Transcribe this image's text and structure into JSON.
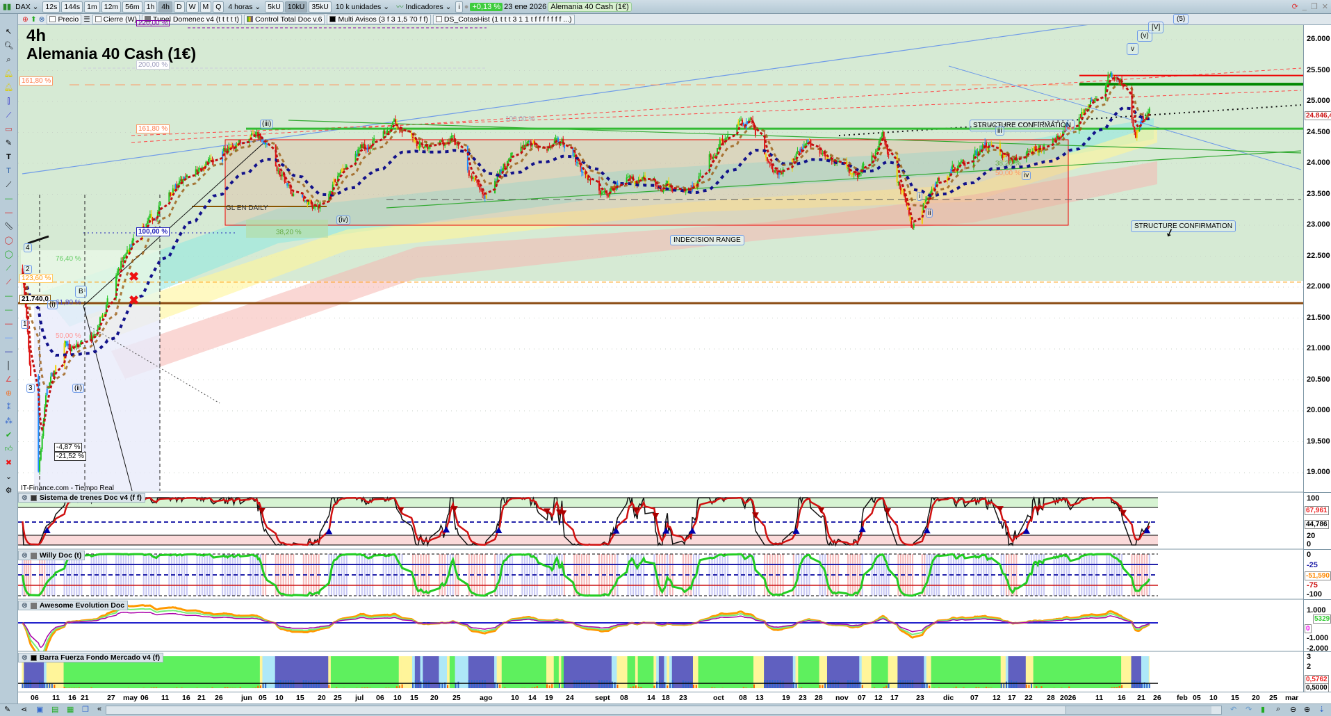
{
  "toolbar": {
    "symbol": "DAX",
    "periods": [
      "12s",
      "144s",
      "1m",
      "12m",
      "56m",
      "1h",
      "4h",
      "D",
      "W",
      "M",
      "Q"
    ],
    "active_period": "4h",
    "period_select": "4 horas",
    "units": [
      "5kU",
      "10kU",
      "35kU"
    ],
    "active_unit": "10kU",
    "units_select": "10 k unidades",
    "indicators": "Indicadores",
    "change": "+0,13 %",
    "date": "23 ene 2026",
    "instrument": "Alemania 40 Cash (1€)"
  },
  "indicator_bar": {
    "items": [
      "Precio",
      "Cierre (W)",
      "Tunel Domenec v4 (t t t t t)",
      "Control Total Doc v.6",
      "Multi Avisos (3 f 3 1,5 70 f f)",
      "DS_CotasHist (1 t t t 3 1 1 t f f f f f f f ...)"
    ]
  },
  "chart_title": {
    "timeframe": "4h",
    "name": "Alemania 40 Cash (1€)"
  },
  "source": "IT-Finance.com - Tiempo Real",
  "annotations": {
    "fib220": "220,00 %",
    "fib200": "200,00 %",
    "fib1618a": "161,80 %",
    "fib1618b": "161,80 %",
    "fib100": "100,00 %",
    "fib764": "76,40 %",
    "fib1236": "123,60 %",
    "level": "21.740,0",
    "fib618": "61,80 %",
    "fib50": "50,00 %",
    "fib382": "38,20 %",
    "fib100b": "100,00 %",
    "fib382b": "38,20 %",
    "fib50b": "50,00 %",
    "gl_daily": "GL EN DAILY",
    "indecision": "INDECISION RANGE",
    "structure1": "STRUCTURE CONFIRMATION",
    "structure2": "STRUCTURE CONFIRMATION",
    "pct1": "-4,87 %",
    "pct2": "-21,52 %"
  },
  "waves": {
    "w_iii": "(iii)",
    "w_iv": "(iv)",
    "w3": "iii",
    "w4": "iv",
    "w1": "i",
    "w2": "ii",
    "wv": "v",
    "wv2": "(v)",
    "wV": "[V]",
    "w5": "(5)",
    "wB": "B",
    "wi": "(i)",
    "wii": "(ii)",
    "n4": "4",
    "n2": "2",
    "n1": "1",
    "n3": "3"
  },
  "price_axis": {
    "ticks": [
      26000,
      25500,
      25000,
      24500,
      24000,
      23500,
      23000,
      22500,
      22000,
      21500,
      21000,
      20500,
      20000,
      19500,
      19000
    ],
    "labels": [
      "26.000",
      "25.500",
      "25.000",
      "24.500",
      "24.000",
      "23.500",
      "23.000",
      "22.500",
      "22.000",
      "21.500",
      "21.000",
      "20.500",
      "20.000",
      "19.500",
      "19.000"
    ],
    "last_price": "24.846,4"
  },
  "panes": {
    "sistema": {
      "title": "Sistema de trenes Doc v4 (f f)",
      "ticks": [
        "100",
        "20",
        "0"
      ],
      "value1": "67,961",
      "value2": "44,786"
    },
    "willy": {
      "title": "Willy Doc (t)",
      "ticks": [
        "0",
        "-25",
        "-75",
        "-100"
      ],
      "value": "-51,590"
    },
    "awesome": {
      "title": "Awesome Evolution Doc",
      "ticks": [
        "1.000",
        "-1.000",
        "-2.000"
      ],
      "value1": "0",
      "value2": "5329"
    },
    "barra": {
      "title": "Barra Fuerza Fondo Mercado v4 (f)",
      "ticks": [
        "3",
        "2"
      ],
      "value1": "0,5762",
      "value2": "0,5000"
    }
  },
  "date_axis": [
    "06",
    "11",
    "16",
    "21",
    "27",
    "may",
    "06",
    "11",
    "16",
    "21",
    "26",
    "jun",
    "05",
    "10",
    "15",
    "20",
    "25",
    "jul",
    "06",
    "10",
    "15",
    "20",
    "25",
    "ago",
    "10",
    "14",
    "19",
    "24",
    "sept",
    "08",
    "14",
    "18",
    "23",
    "oct",
    "08",
    "13",
    "19",
    "23",
    "28",
    "nov",
    "07",
    "12",
    "17",
    "23",
    "dic",
    "07",
    "12",
    "17",
    "22",
    "28",
    "2026",
    "11",
    "16",
    "21",
    "26",
    "feb",
    "05",
    "10",
    "15",
    "20",
    "25",
    "mar"
  ],
  "chart_data": {
    "type": "candlestick",
    "title": "Alemania 40 Cash (1€) 4h",
    "ylim": [
      18800,
      26300
    ],
    "close_path": [
      [
        "2025-04-02",
        22300
      ],
      [
        "2025-04-07",
        19000
      ],
      [
        "2025-04-09",
        20300
      ],
      [
        "2025-04-14",
        21000
      ],
      [
        "2025-04-22",
        21200
      ],
      [
        "2025-04-30",
        22500
      ],
      [
        "2025-05-12",
        23500
      ],
      [
        "2025-05-20",
        23900
      ],
      [
        "2025-05-28",
        24300
      ],
      [
        "2025-06-05",
        24400
      ],
      [
        "2025-06-13",
        23500
      ],
      [
        "2025-06-20",
        23300
      ],
      [
        "2025-06-30",
        24200
      ],
      [
        "2025-07-10",
        24600
      ],
      [
        "2025-07-18",
        24200
      ],
      [
        "2025-07-24",
        24400
      ],
      [
        "2025-08-01",
        23400
      ],
      [
        "2025-08-08",
        24100
      ],
      [
        "2025-08-14",
        24300
      ],
      [
        "2025-08-22",
        24300
      ],
      [
        "2025-09-02",
        23500
      ],
      [
        "2025-09-10",
        23700
      ],
      [
        "2025-09-25",
        23600
      ],
      [
        "2025-10-02",
        24400
      ],
      [
        "2025-10-09",
        24700
      ],
      [
        "2025-10-17",
        23800
      ],
      [
        "2025-10-24",
        24300
      ],
      [
        "2025-10-30",
        24100
      ],
      [
        "2025-11-06",
        23800
      ],
      [
        "2025-11-13",
        24400
      ],
      [
        "2025-11-21",
        23000
      ],
      [
        "2025-11-28",
        23700
      ],
      [
        "2025-12-05",
        24000
      ],
      [
        "2025-12-12",
        24300
      ],
      [
        "2025-12-18",
        24000
      ],
      [
        "2025-12-30",
        24450
      ],
      [
        "2026-01-06",
        24800
      ],
      [
        "2026-01-13",
        25450
      ],
      [
        "2026-01-16",
        25300
      ],
      [
        "2026-01-20",
        24500
      ],
      [
        "2026-01-23",
        24850
      ]
    ],
    "levels": {
      "resistance_red": 25420,
      "resistance_green": 25280,
      "range_top": 24560,
      "range_box": [
        23000,
        24400
      ],
      "support_brown": 21740,
      "fib_dashed": 22080
    },
    "colors": {
      "up": "#1fc41f",
      "down": "#e01010",
      "bg": "#d6ead4"
    }
  }
}
